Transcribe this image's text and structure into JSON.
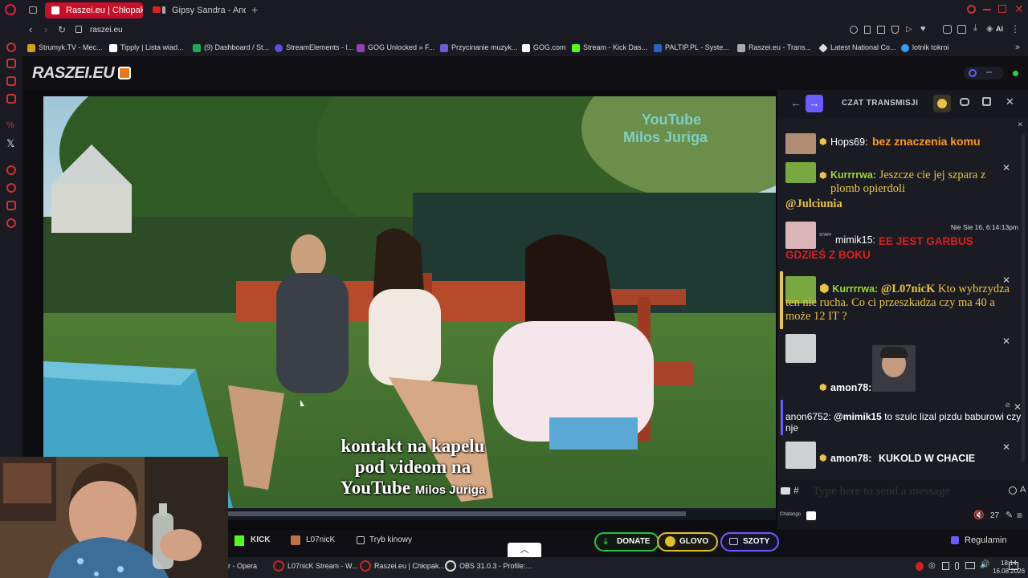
{
  "browser": {
    "tabs": [
      {
        "title": "Raszei.eu | Chłopaki z l",
        "active": true
      },
      {
        "title": "Gipsy Sandra - Andro s",
        "active": false
      }
    ],
    "url": "raszei.eu",
    "ai_label": "AI",
    "bookmarks": [
      {
        "label": "Strumyk.TV - Mec...",
        "color": "#d4a017"
      },
      {
        "label": "Tipply | Lista wiad...",
        "color": "#ffffff"
      },
      {
        "label": "(9) Dashboard / St...",
        "color": "#1da85b"
      },
      {
        "label": "StreamElements - l...",
        "color": "#5b4ee6"
      },
      {
        "label": "GOG Unlocked » F...",
        "color": "#8e44ad"
      },
      {
        "label": "Przycinanie muzyk...",
        "color": "#6e5bd6"
      },
      {
        "label": "GOG.com",
        "color": "#ffffff"
      },
      {
        "label": "Stream - Kick Das...",
        "color": "#53fc18"
      },
      {
        "label": "PALTIP.PL - Syste...",
        "color": "#2b62c9"
      },
      {
        "label": "Raszei.eu - Trans...",
        "color": "#aaaaaa"
      },
      {
        "label": "Latest National Co...",
        "color": "#dddddd"
      },
      {
        "label": "lotnik tokroi",
        "color": "#3a9be8"
      }
    ]
  },
  "site": {
    "logo": "RASZEI.EU",
    "viewer_count": "--"
  },
  "video": {
    "watermark_line1": "YouTube",
    "watermark_line2": "Milos Juriga",
    "caption_line1": "kontakt na kapelu",
    "caption_line2": "pod videom na",
    "caption_line3": "YouTube",
    "caption_name": "Milos Juriga"
  },
  "chat": {
    "title": "CZAT TRANSMISJI",
    "messages": [
      {
        "user": "Hops69:",
        "text": "bez znaczenia komu"
      },
      {
        "user": "Kurrrrwa:",
        "text": "Jeszcze cie jej szpara z plomb opierdoli",
        "mention": "@Julciunia"
      },
      {
        "timestamp": "Nie Sie 16, 6:14:13pm",
        "user": "mimik15:",
        "badge": "STAFF",
        "text": "EE JEST GARBUS GDZIEŚ Z BOKU"
      },
      {
        "user": "Kurrrrwa:",
        "mention": "@L07nicK",
        "text": "Kto wybrzydza ten nie rucha. Co ci przeszkadza czy ma 40 a może 12 IT ?"
      },
      {
        "user": "amon78:",
        "text": ""
      },
      {
        "user": "anon6752:",
        "mention": "@mimik15",
        "text": "to szulc lizal pizdu baburowi czy nje"
      },
      {
        "user": "amon78:",
        "text": "KUKOLD W CHACIE"
      }
    ],
    "input_placeholder": "Type here to send a message",
    "hash_symbol": "#",
    "footer_label": "Chatango",
    "count": "27"
  },
  "bottom": {
    "kick_label": "KICK",
    "channel_label": "L07nicK",
    "cinema_label": "Tryb kinowy",
    "donate_label": "DONATE",
    "glovo_label": "GLOVO",
    "szoty_label": "SZOTY",
    "rules_label": "Regulamin"
  },
  "taskbar": {
    "items": [
      {
        "label": "r - Opera"
      },
      {
        "label": "L07nicK Stream - W..."
      },
      {
        "label": "Raszei.eu | Chłopak..."
      },
      {
        "label": "OBS 31.0.3 - Profile:..."
      }
    ],
    "time": "18:14",
    "date": "16.08.2026"
  },
  "colors": {
    "opera_red": "#c9102a",
    "kick_green": "#53fc18",
    "chat_gold": "#e8c547",
    "chat_orange": "#ff9a1f",
    "staff_red": "#e02020",
    "accent_purple": "#6a5cff"
  }
}
